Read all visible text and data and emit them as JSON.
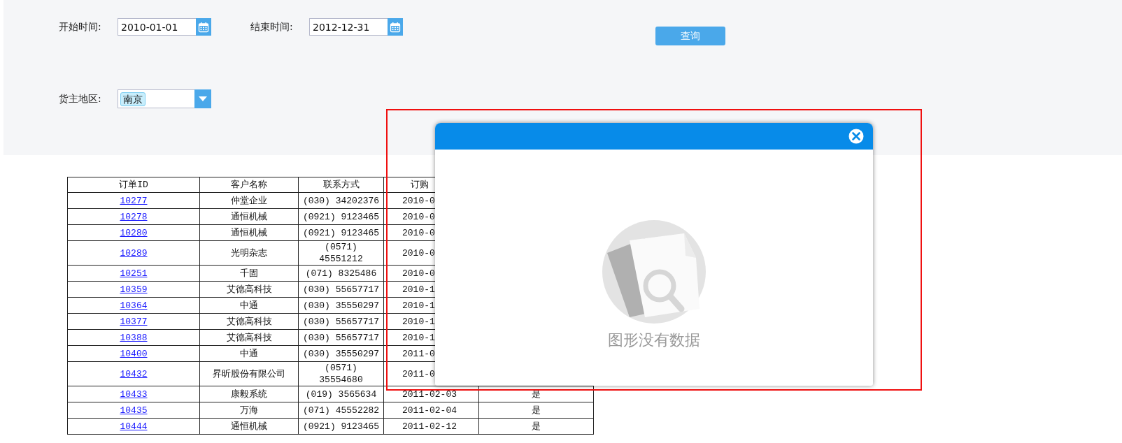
{
  "filters": {
    "start_time": {
      "label": "开始时间:",
      "value": "2010-01-01"
    },
    "end_time": {
      "label": "结束时间:",
      "value": "2012-12-31"
    },
    "query_button": "查询",
    "region": {
      "label": "货主地区:",
      "tags": [
        "南京"
      ]
    }
  },
  "table": {
    "columns": [
      "订单ID",
      "客户名称",
      "联系方式",
      "订购"
    ],
    "rows": [
      {
        "order_id": "10277",
        "customer": "仲堂企业",
        "phone": "(030) 34202376",
        "date": "2010-0"
      },
      {
        "order_id": "10278",
        "customer": "通恒机械",
        "phone": "(0921) 9123465",
        "date": "2010-0"
      },
      {
        "order_id": "10280",
        "customer": "通恒机械",
        "phone": "(0921) 9123465",
        "date": "2010-0"
      },
      {
        "order_id": "10289",
        "customer": "光明杂志",
        "phone": "(0571) 45551212",
        "date": "2010-0"
      },
      {
        "order_id": "10251",
        "customer": "千固",
        "phone": "(071) 8325486",
        "date": "2010-0"
      },
      {
        "order_id": "10359",
        "customer": "艾德高科技",
        "phone": "(030) 55657717",
        "date": "2010-1"
      },
      {
        "order_id": "10364",
        "customer": "中通",
        "phone": "(030) 35550297",
        "date": "2010-1"
      },
      {
        "order_id": "10377",
        "customer": "艾德高科技",
        "phone": "(030) 55657717",
        "date": "2010-1"
      },
      {
        "order_id": "10388",
        "customer": "艾德高科技",
        "phone": "(030) 55657717",
        "date": "2010-1"
      },
      {
        "order_id": "10400",
        "customer": "中通",
        "phone": "(030) 35550297",
        "date": "2011-0"
      },
      {
        "order_id": "10432",
        "customer": "昇昕股份有限公司",
        "phone": "(0571) 35554680",
        "date": "2011-0"
      },
      {
        "order_id": "10433",
        "customer": "康毅系统",
        "phone": "(019) 3565634",
        "date": "2011-02-03",
        "column_5": "是"
      },
      {
        "order_id": "10435",
        "customer": "万海",
        "phone": "(071) 45552282",
        "date": "2011-02-04",
        "column_5": "是"
      },
      {
        "order_id": "10444",
        "customer": "通恒机械",
        "phone": "(0921) 9123465",
        "date": "2011-02-12",
        "column_5": "是"
      }
    ]
  },
  "dialog": {
    "empty_message": "图形没有数据"
  }
}
